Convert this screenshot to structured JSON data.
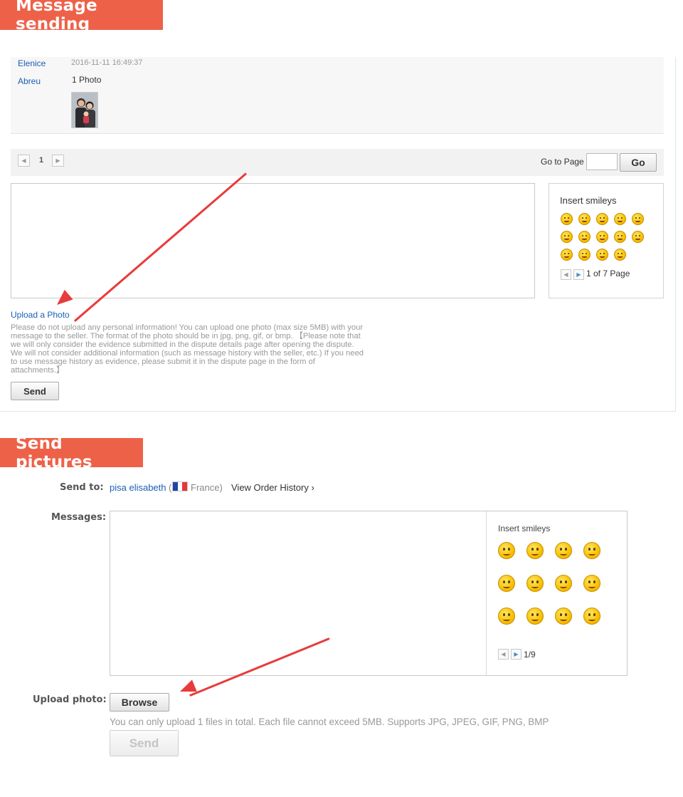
{
  "section1": {
    "banner": "Message sending",
    "message": {
      "sender_first": "Elenice",
      "sender_last": "Abreu",
      "timestamp": "2016-11-11 16:49:37",
      "body": "1 Photo"
    },
    "pager": {
      "prev": "◀",
      "current": "1",
      "next": "▶",
      "goto_label": "Go to Page",
      "goto_value": "",
      "go_button": "Go"
    },
    "smileys": {
      "title": "Insert smileys",
      "page_info": "1 of 7 Page",
      "prev": "◀",
      "next": "▶"
    },
    "upload_link": "Upload a Photo",
    "notice": "Please do not upload any personal information! You can upload one photo (max size 5MB) with your message to the seller. The format of the photo should be in jpg, png, gif, or bmp. 【Please note that we will only consider the evidence submitted in the dispute details page after opening the dispute. We will not consider additional information (such as message history with the seller, etc.) If you need to use message history as evidence, please submit it in the dispute page in the form of attachments.】",
    "send_button": "Send"
  },
  "section2": {
    "banner": "Send pictures",
    "send_to_label": "Send to:",
    "recipient_name": "pisa elisabeth",
    "recipient_paren_open": "(",
    "recipient_country": "France)",
    "order_history": "View Order History ›",
    "messages_label": "Messages:",
    "messages_value": "",
    "smileys": {
      "title": "Insert smileys",
      "page_info": "1/9",
      "prev": "◀",
      "next": "▶"
    },
    "upload_label": "Upload photo:",
    "browse_button": "Browse",
    "upload_hint": "You can only upload 1 files in total. Each file cannot exceed 5MB. Supports JPG, JPEG, GIF, PNG, BMP",
    "send_button": "Send"
  },
  "colors": {
    "banner": "#ee6149",
    "link": "#1a5fb4",
    "arrow": "#e83b3b"
  }
}
